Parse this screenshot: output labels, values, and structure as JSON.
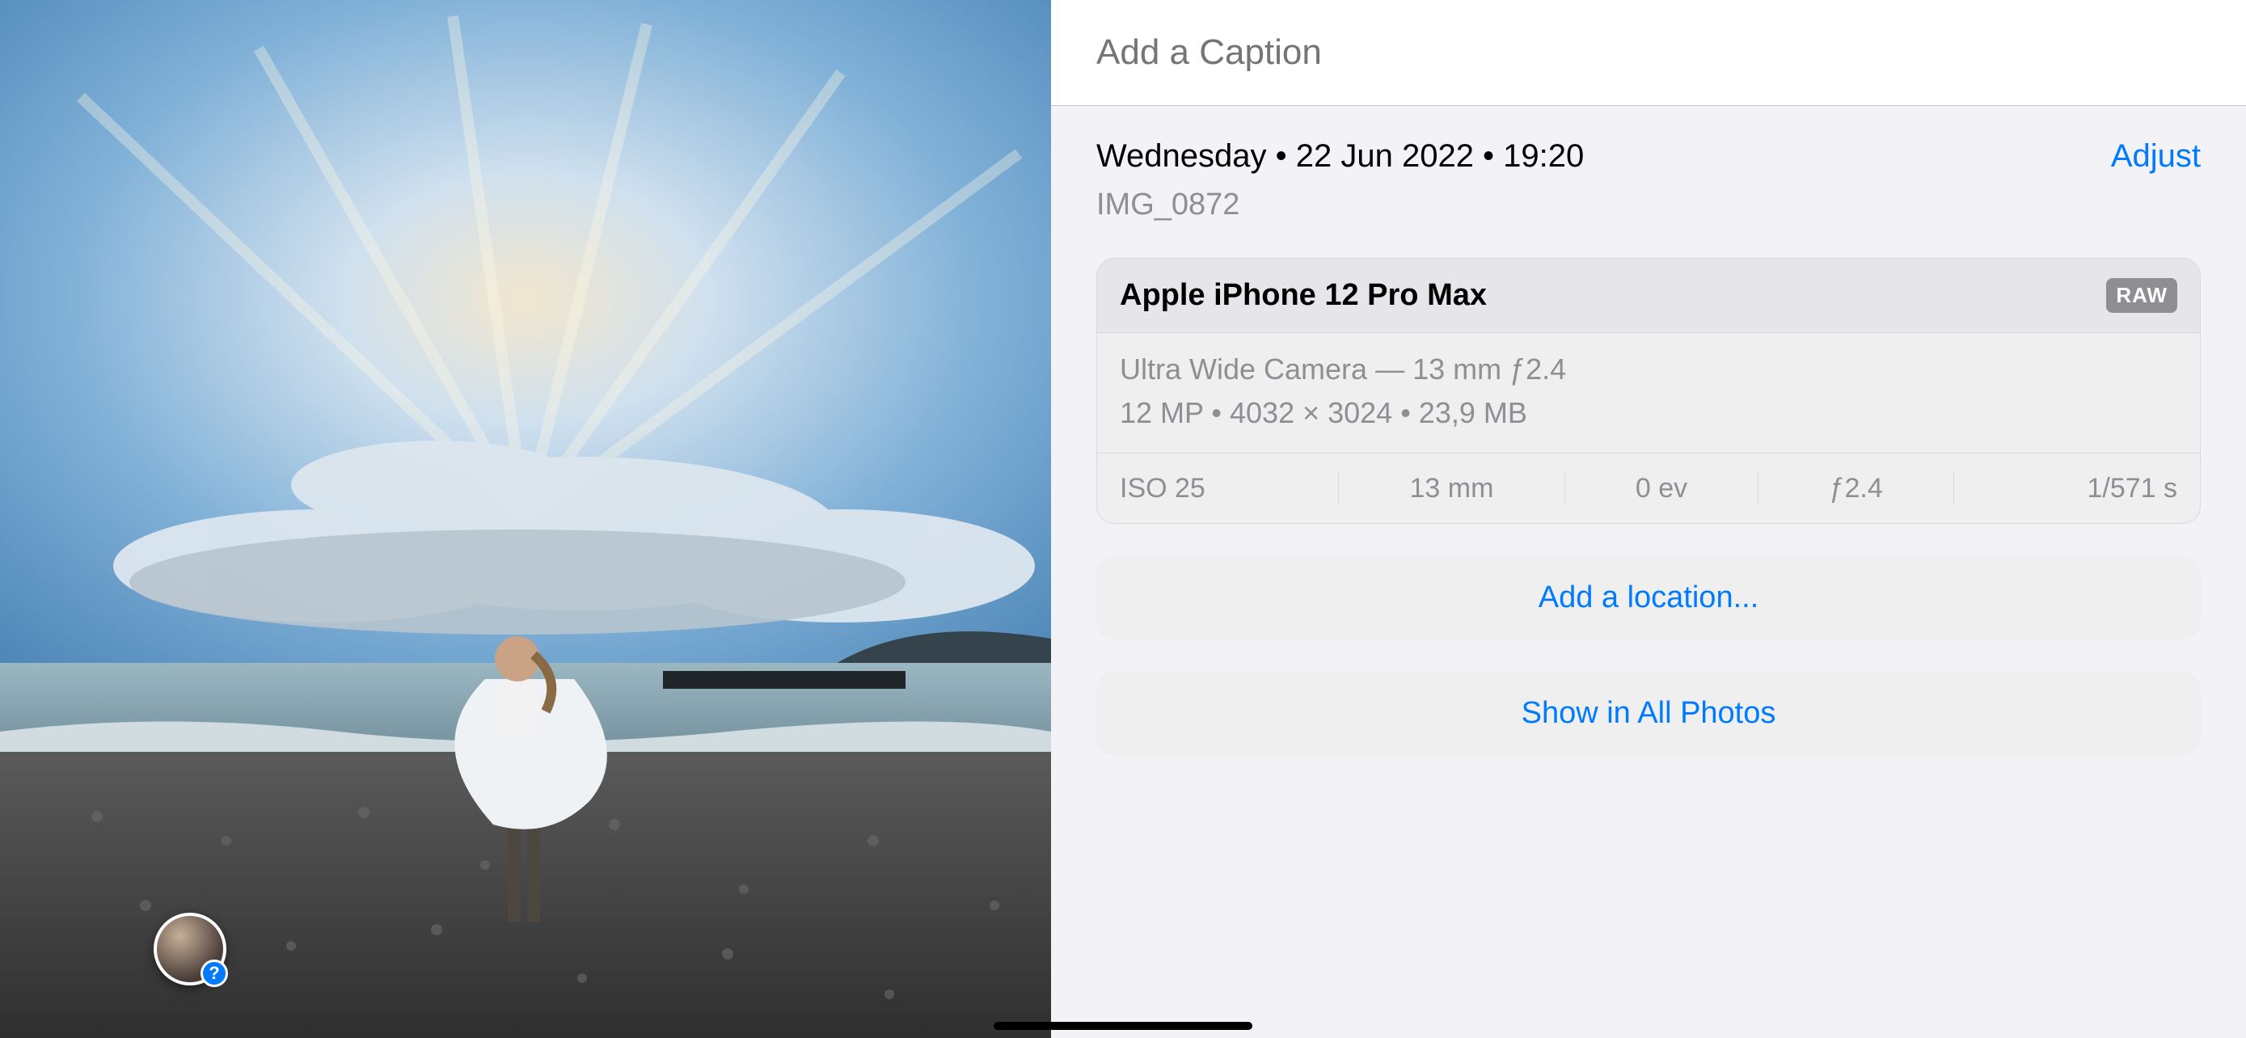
{
  "caption": {
    "placeholder": "Add a Caption"
  },
  "date_line": "Wednesday • 22 Jun 2022 • 19:20",
  "adjust_label": "Adjust",
  "filename": "IMG_0872",
  "camera": {
    "device": "Apple iPhone 12 Pro Max",
    "raw_badge": "RAW",
    "lens_line": "Ultra Wide Camera — 13 mm ƒ2.4",
    "img_line": "12 MP  •  4032 × 3024  •  23,9 MB",
    "iso": "ISO 25",
    "focal": "13 mm",
    "ev": "0 ev",
    "aperture": "ƒ2.4",
    "shutter": "1/571 s"
  },
  "actions": {
    "add_location": "Add a location...",
    "show_in_all": "Show in All Photos"
  }
}
